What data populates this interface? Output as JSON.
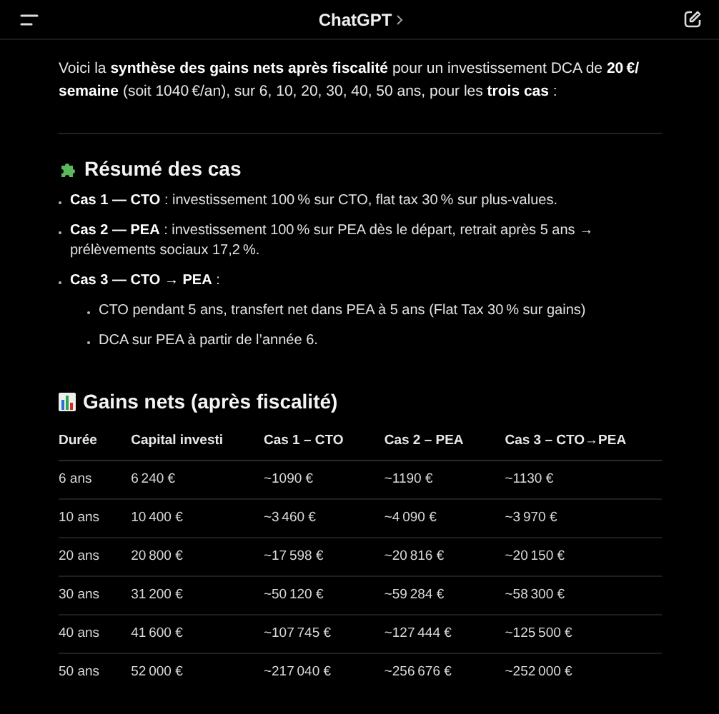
{
  "header": {
    "title": "ChatGPT"
  },
  "intro": "Voici la **synthèse des gains nets après fiscalité** pour un investissement DCA de **20 €/ semaine** (soit 1040 €/an), sur 6, 10, 20, 30, 40, 50 ans, pour les **trois cas** :",
  "summary": {
    "heading": "Résumé des cas",
    "items": [
      {
        "text": "**Cas 1 — CTO** : investissement 100 % sur CTO, flat tax 30 % sur plus-values."
      },
      {
        "text": "**Cas 2 — PEA** : investissement 100 % sur PEA dès le départ, retrait après 5 ans → prélèvements sociaux 17,2 %."
      },
      {
        "text": "**Cas 3 — CTO → PEA** :",
        "children": [
          {
            "text": "CTO pendant 5 ans, transfert net dans PEA à 5 ans (Flat Tax 30 % sur gains)"
          },
          {
            "text": "DCA sur PEA à partir de l’année 6."
          }
        ]
      }
    ]
  },
  "gains": {
    "heading": "Gains nets (après fiscalité)",
    "table": {
      "columns": [
        "Durée",
        "Capital investi",
        "Cas 1 – CTO",
        "Cas 2 – PEA",
        "Cas 3 – CTO→PEA"
      ],
      "rows": [
        [
          "6 ans",
          "6 240 €",
          "~1090 €",
          "~1190 €",
          "~1130 €"
        ],
        [
          "10 ans",
          "10 400 €",
          "~3 460 €",
          "~4 090 €",
          "~3 970 €"
        ],
        [
          "20 ans",
          "20 800 €",
          "~17 598 €",
          "~20 816 €",
          "~20 150 €"
        ],
        [
          "30 ans",
          "31 200 €",
          "~50 120 €",
          "~59 284 €",
          "~58 300 €"
        ],
        [
          "40 ans",
          "41 600 €",
          "~107 745 €",
          "~127 444 €",
          "~125 500 €"
        ],
        [
          "50 ans",
          "52 000 €",
          "~217 040 €",
          "~256 676 €",
          "~252 000 €"
        ]
      ]
    }
  }
}
